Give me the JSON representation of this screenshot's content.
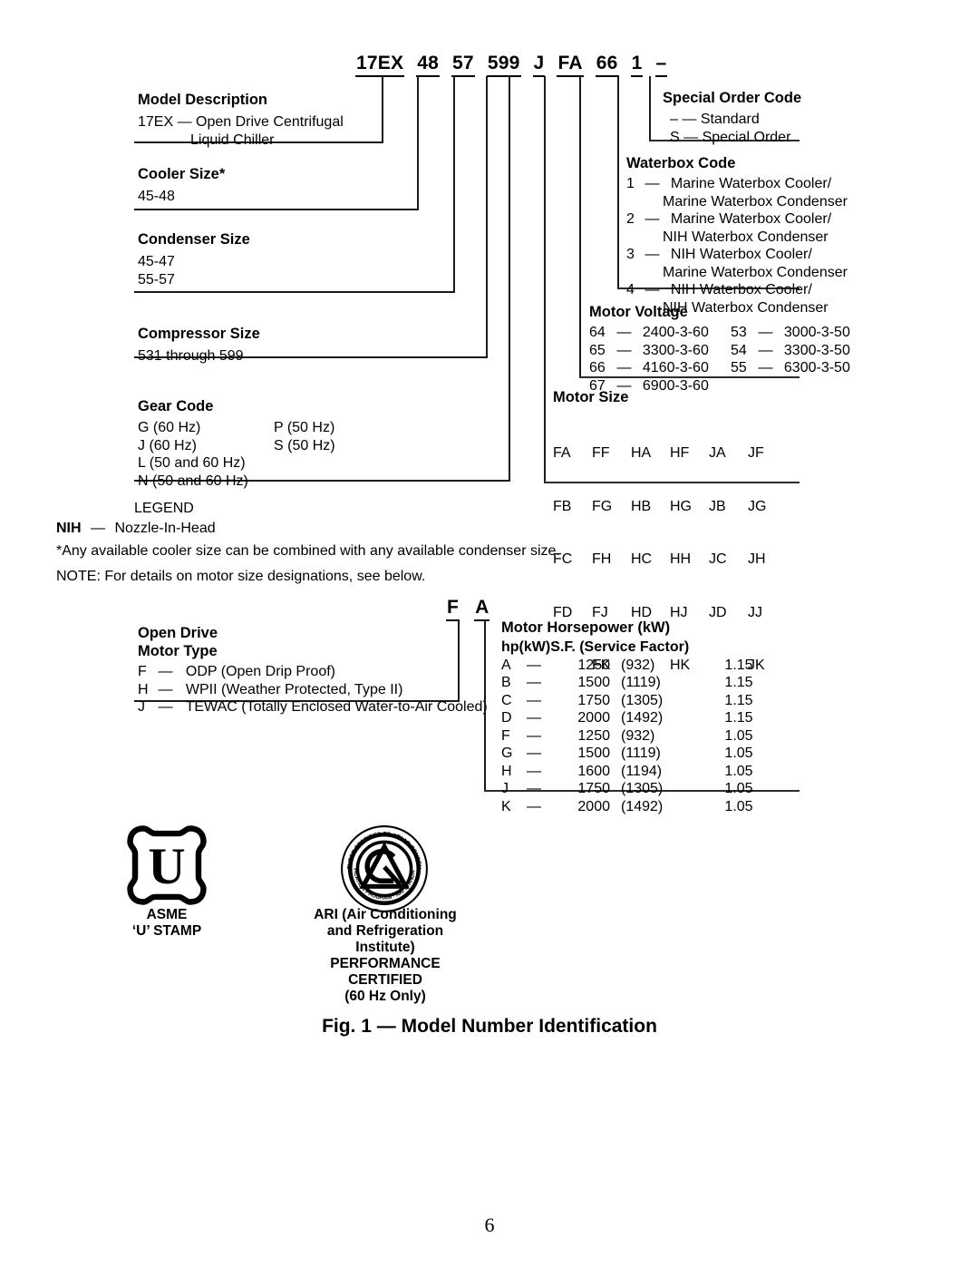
{
  "page": {
    "number": "6",
    "caption": "Fig. 1 — Model Number Identification"
  },
  "model_number": {
    "segments": [
      "17EX",
      "48",
      "57",
      "599",
      "J",
      "FA",
      "66",
      "1",
      "–"
    ]
  },
  "left_blocks": [
    {
      "title": "Model Description",
      "lines": [
        "17EX — Open Drive Centrifugal",
        "Liquid Chiller"
      ]
    },
    {
      "title": "Cooler Size*",
      "lines": [
        "45-48"
      ]
    },
    {
      "title": "Condenser Size",
      "lines": [
        "45-47",
        "55-57"
      ]
    },
    {
      "title": "Compressor Size",
      "lines": [
        "531 through 599"
      ]
    },
    {
      "title": "Gear Code",
      "col_a": [
        "G (60 Hz)",
        "J (60 Hz)",
        "L (50 and 60 Hz)",
        "N (50 and 60 Hz)"
      ],
      "col_b": [
        "P (50 Hz)",
        "S (50 Hz)"
      ]
    }
  ],
  "right_blocks": {
    "special_order": {
      "title": "Special Order Code",
      "items": [
        {
          "code": "–",
          "dash": "—",
          "text": "Standard"
        },
        {
          "code": "S",
          "dash": "—",
          "text": "Special Order"
        }
      ]
    },
    "waterbox": {
      "title": "Waterbox Code",
      "items": [
        {
          "code": "1",
          "dash": "—",
          "line1": "Marine Waterbox Cooler/",
          "line2": "Marine Waterbox Condenser"
        },
        {
          "code": "2",
          "dash": "—",
          "line1": "Marine Waterbox Cooler/",
          "line2": "NIH Waterbox Condenser"
        },
        {
          "code": "3",
          "dash": "—",
          "line1": "NIH Waterbox Cooler/",
          "line2": "Marine Waterbox Condenser"
        },
        {
          "code": "4",
          "dash": "—",
          "line1": "NIH Waterbox Cooler/",
          "line2": "NIH Waterbox Condenser"
        }
      ]
    },
    "motor_voltage": {
      "title": "Motor Voltage",
      "col_a": [
        {
          "code": "64",
          "dash": "—",
          "value": "2400-3-60"
        },
        {
          "code": "65",
          "dash": "—",
          "value": "3300-3-60"
        },
        {
          "code": "66",
          "dash": "—",
          "value": "4160-3-60"
        },
        {
          "code": "67",
          "dash": "—",
          "value": "6900-3-60"
        }
      ],
      "col_b": [
        {
          "code": "53",
          "dash": "—",
          "value": "3000-3-50"
        },
        {
          "code": "54",
          "dash": "—",
          "value": "3300-3-50"
        },
        {
          "code": "55",
          "dash": "—",
          "value": "6300-3-50"
        }
      ]
    },
    "motor_size": {
      "title": "Motor Size",
      "columns": [
        [
          "FA",
          "FB",
          "FC",
          "FD",
          ""
        ],
        [
          "FF",
          "FG",
          "FH",
          "FJ",
          "FK"
        ],
        [
          "HA",
          "HB",
          "HC",
          "HD",
          ""
        ],
        [
          "HF",
          "HG",
          "HH",
          "HJ",
          "HK"
        ],
        [
          "JA",
          "JB",
          "JC",
          "JD",
          ""
        ],
        [
          "JF",
          "JG",
          "JH",
          "JJ",
          "JK"
        ]
      ]
    }
  },
  "legend": {
    "title": "LEGEND",
    "abbr": "NIH",
    "abbr_dash": "—",
    "abbr_text": "Nozzle-In-Head",
    "footnote": "*Any available cooler size can be combined with any available condenser size.",
    "note": "NOTE: For details on motor size designations, see below."
  },
  "lower_diagram": {
    "segments": [
      "F",
      "A"
    ],
    "open_drive": {
      "title_line1": "Open Drive",
      "title_line2": "Motor Type",
      "items": [
        {
          "code": "F",
          "dash": "—",
          "text": "ODP (Open Drip Proof)"
        },
        {
          "code": "H",
          "dash": "—",
          "text": "WPII (Weather Protected, Type II)"
        },
        {
          "code": "J",
          "dash": "—",
          "text": "TEWAC (Totally Enclosed Water-to-Air Cooled)"
        }
      ]
    },
    "horsepower": {
      "title": "Motor Horsepower (kW)",
      "head_hp": "hp",
      "head_kw": "(kW)",
      "head_sf": "S.F. (Service Factor)",
      "rows": [
        {
          "code": "A",
          "dash": "—",
          "hp": "1250",
          "kw": "(932)",
          "sf": "1.15"
        },
        {
          "code": "B",
          "dash": "—",
          "hp": "1500",
          "kw": "(1119)",
          "sf": "1.15"
        },
        {
          "code": "C",
          "dash": "—",
          "hp": "1750",
          "kw": "(1305)",
          "sf": "1.15"
        },
        {
          "code": "D",
          "dash": "—",
          "hp": "2000",
          "kw": "(1492)",
          "sf": "1.15"
        },
        {
          "code": "F",
          "dash": "—",
          "hp": "1250",
          "kw": "(932)",
          "sf": "1.05"
        },
        {
          "code": "G",
          "dash": "—",
          "hp": "1500",
          "kw": "(1119)",
          "sf": "1.05"
        },
        {
          "code": "H",
          "dash": "—",
          "hp": "1600",
          "kw": "(1194)",
          "sf": "1.05"
        },
        {
          "code": "J",
          "dash": "—",
          "hp": "1750",
          "kw": "(1305)",
          "sf": "1.05"
        },
        {
          "code": "K",
          "dash": "—",
          "hp": "2000",
          "kw": "(1492)",
          "sf": "1.05"
        }
      ]
    }
  },
  "logos": {
    "asme": {
      "glyph": "U",
      "label_line1": "ASME",
      "label_line2": "‘U’ STAMP"
    },
    "ari": {
      "ring_top_text": "MANUFACTURER CERTIFIED TO ARI AC CONDENSING UNIT",
      "ring_bottom_text": "CERTIFICATION PROGRAM · ARI STANDARD 550",
      "label_line1": "ARI (Air Conditioning",
      "label_line2": "and Refrigeration",
      "label_line3": "Institute)",
      "label_line4": "PERFORMANCE",
      "label_line5": "CERTIFIED",
      "label_line6": "(60 Hz Only)"
    }
  }
}
